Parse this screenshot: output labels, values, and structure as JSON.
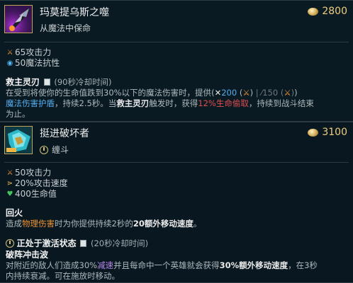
{
  "items": [
    {
      "name": "玛莫提乌斯之噬",
      "subtitle": "从魔法中保命",
      "price": "2800",
      "stats": [
        {
          "icon": "attack-damage-icon",
          "text": "65攻击力"
        },
        {
          "icon": "magic-resist-icon",
          "text": "50魔法抗性"
        }
      ],
      "passive": {
        "title": "救主灵刃",
        "cooldown": "(90秒冷却时间)",
        "line1": "在受到将使你的生命值跌到30%以下的魔法伤害时，提供",
        "shield_paren_open": "(",
        "shield_value": "200",
        "bonus_ad_open": "(",
        "bonus_ad_close": ")",
        "sep": "|",
        "grey_value": "150",
        "grey_bonus_open": "(",
        "grey_bonus_close": ")",
        "shield_paren_close": ")",
        "line2_a": "魔法伤害护盾",
        "line2_b": "，持续2.5秒。当",
        "line2_c": "救主灵刃",
        "line2_d": "触发时，获得",
        "line2_e": "12%生命偷取",
        "line2_f": "，持续到战斗结束",
        "line3": "为止。"
      }
    },
    {
      "name": "挺进破坏者",
      "tag": "缠斗",
      "price": "3100",
      "stats": [
        {
          "icon": "attack-damage-icon",
          "text": "50攻击力"
        },
        {
          "icon": "attack-speed-icon",
          "text": "20%攻击速度"
        },
        {
          "icon": "health-icon",
          "text": "400生命值"
        }
      ],
      "passive": {
        "title": "回火",
        "desc_a": "造成",
        "desc_b": "物理伤害",
        "desc_c": "时为你提供持续2秒的",
        "desc_d": "20额外移动速度",
        "desc_e": "。"
      },
      "active": {
        "status_label": "正处于激活状态",
        "cooldown": "(20秒冷却时间)",
        "title": "破阵冲击波",
        "line1_a": "对附近的敌人们造成30%",
        "line1_b": "减速",
        "line1_c": "并且每命中一个英雄就会获得",
        "line1_d": "30%额外移动速度",
        "line1_e": "，在3秒",
        "line2": "内持续衰减。可在施放时移动。"
      }
    }
  ]
}
